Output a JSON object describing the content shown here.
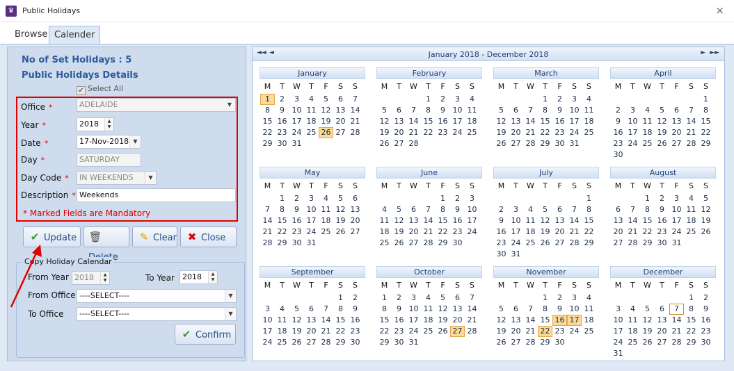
{
  "window": {
    "title": "Public Holidays",
    "icon": "app-icon",
    "close_label": "×"
  },
  "tabs": {
    "browse": "Browse",
    "calender": "Calender",
    "active": "Calender"
  },
  "left": {
    "set_holidays": "No of Set Holidays : 5",
    "details_heading": "Public Holidays Details",
    "select_all": "Select All",
    "fields": {
      "office_label": "Office",
      "office_value": "ADELAIDE",
      "year_label": "Year",
      "year_value": "2018",
      "date_label": "Date",
      "date_value": "17-Nov-2018",
      "day_label": "Day",
      "day_value": "SATURDAY",
      "daycode_label": "Day Code",
      "daycode_value": "IN WEEKENDS",
      "description_label": "Description",
      "description_value": "Weekends",
      "required_mark": "*"
    },
    "mandatory_note": "* Marked Fields are Mandatory",
    "buttons": {
      "update": "Update",
      "delete": "Delete",
      "clear": "Clear",
      "close": "Close"
    },
    "copy": {
      "legend": "Copy Holiday Calendar",
      "from_year_label": "From Year",
      "from_year_value": "2018",
      "to_year_label": "To Year",
      "to_year_value": "2018",
      "from_office_label": "From Office",
      "from_office_value": "----SELECT----",
      "to_office_label": "To Office",
      "to_office_value": "----SELECT----",
      "confirm": "Confirm"
    }
  },
  "calendar": {
    "title": "January 2018 - December 2018",
    "nav": {
      "first": "◄◄",
      "prev": "◄",
      "next": "►",
      "last": "►►"
    },
    "weekdays": [
      "M",
      "T",
      "W",
      "T",
      "F",
      "S",
      "S"
    ],
    "months": [
      {
        "name": "January",
        "offset": 0,
        "days": 31,
        "highlight": [
          1,
          26
        ],
        "today": []
      },
      {
        "name": "February",
        "offset": 3,
        "days": 28,
        "highlight": [],
        "today": []
      },
      {
        "name": "March",
        "offset": 3,
        "days": 31,
        "highlight": [],
        "today": []
      },
      {
        "name": "April",
        "offset": 6,
        "days": 30,
        "highlight": [],
        "today": []
      },
      {
        "name": "May",
        "offset": 1,
        "days": 31,
        "highlight": [],
        "today": []
      },
      {
        "name": "June",
        "offset": 4,
        "days": 30,
        "highlight": [],
        "today": []
      },
      {
        "name": "July",
        "offset": 6,
        "days": 31,
        "highlight": [],
        "today": []
      },
      {
        "name": "August",
        "offset": 2,
        "days": 31,
        "highlight": [],
        "today": []
      },
      {
        "name": "September",
        "offset": 5,
        "days": 30,
        "highlight": [],
        "today": []
      },
      {
        "name": "October",
        "offset": 0,
        "days": 31,
        "highlight": [
          27
        ],
        "today": []
      },
      {
        "name": "November",
        "offset": 3,
        "days": 30,
        "highlight": [
          16,
          17,
          22
        ],
        "today": []
      },
      {
        "name": "December",
        "offset": 5,
        "days": 31,
        "highlight": [],
        "today": [
          7
        ]
      }
    ]
  }
}
